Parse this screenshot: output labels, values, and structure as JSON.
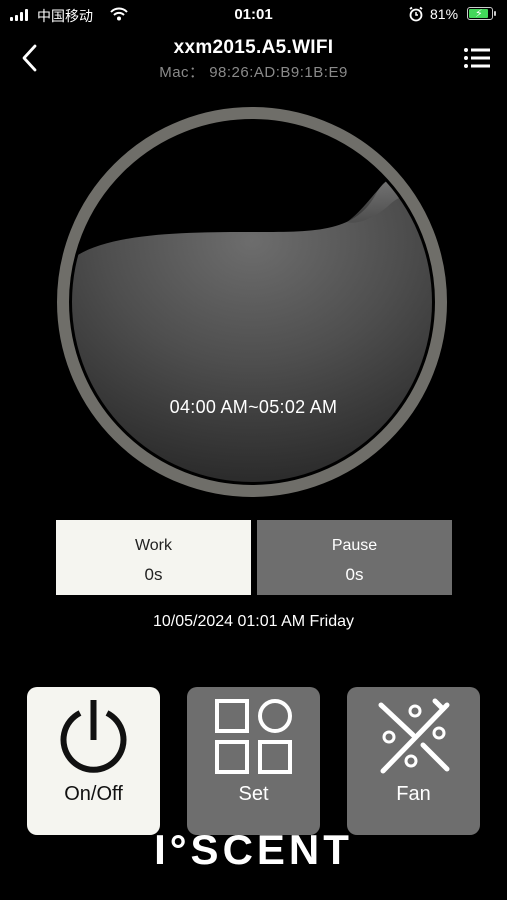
{
  "status_bar": {
    "carrier": "中国移动",
    "time": "01:01",
    "battery_percent": "81%",
    "battery_level": 0.81,
    "charging": true
  },
  "header": {
    "title": "xxm2015.A5.WIFI",
    "mac": "Mac： 98:26:AD:B9:1B:E9"
  },
  "gauge": {
    "time_range": "04:00 AM~05:02 AM"
  },
  "counters": {
    "work_label": "Work",
    "work_value": "0s",
    "pause_label": "Pause",
    "pause_value": "0s"
  },
  "datetime": "10/05/2024 01:01 AM Friday",
  "buttons": {
    "onoff_label": "On/Off",
    "set_label": "Set",
    "fan_label": "Fan"
  },
  "logo": "I°SCENT",
  "colors": {
    "background": "#000000",
    "active": "#f5f5f0",
    "inactive": "#6e6e6e",
    "ring": "#6f6e69",
    "battery": "#43d75a"
  },
  "icons": [
    "signal-icon",
    "wifi-icon",
    "alarm-icon",
    "battery-icon",
    "back-chevron-icon",
    "menu-list-icon",
    "power-icon",
    "grid-icon",
    "fan-icon"
  ]
}
